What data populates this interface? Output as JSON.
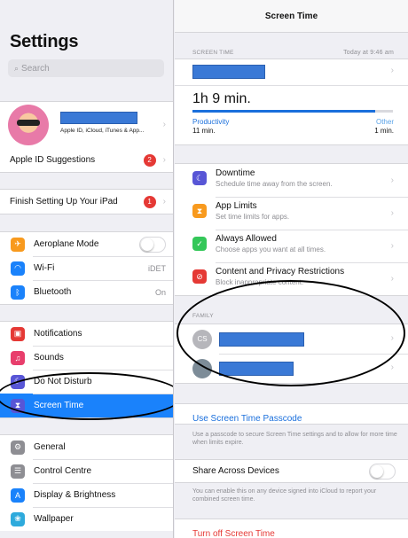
{
  "settings": {
    "title": "Settings",
    "search_placeholder": "Search",
    "apple_id_sub": "Apple ID, iCloud, iTunes & App...",
    "apple_id_suggestions": "Apple ID Suggestions",
    "apple_id_suggestions_badge": "2",
    "finish_setup": "Finish Setting Up Your iPad",
    "finish_setup_badge": "1",
    "connectivity": [
      {
        "label": "Aeroplane Mode",
        "icon": "airplane-icon",
        "color": "#f89a1e"
      },
      {
        "label": "Wi-Fi",
        "icon": "wifi-icon",
        "color": "#1a82fb",
        "value": "iDET"
      },
      {
        "label": "Bluetooth",
        "icon": "bluetooth-icon",
        "color": "#1a82fb",
        "value": "On"
      }
    ],
    "notifications_group": [
      {
        "label": "Notifications",
        "icon": "notifications-icon",
        "color": "#e53935"
      },
      {
        "label": "Sounds",
        "icon": "sounds-icon",
        "color": "#e83e6c"
      },
      {
        "label": "Do Not Disturb",
        "icon": "moon-icon",
        "color": "#5856d6"
      },
      {
        "label": "Screen Time",
        "icon": "hourglass-icon",
        "color": "#5856d6"
      }
    ],
    "general_group": [
      {
        "label": "General",
        "icon": "gear-icon",
        "color": "#8e8e93"
      },
      {
        "label": "Control Centre",
        "icon": "control-centre-icon",
        "color": "#8e8e93"
      },
      {
        "label": "Display & Brightness",
        "icon": "display-icon",
        "color": "#1a82fb"
      },
      {
        "label": "Wallpaper",
        "icon": "wallpaper-icon",
        "color": "#2eaadc"
      }
    ]
  },
  "screen_time": {
    "nav_title": "Screen Time",
    "section_label": "SCREEN TIME",
    "timestamp": "Today at 9:46 am",
    "total": "1h 9 min.",
    "productivity_label": "Productivity",
    "productivity_value": "11 min.",
    "other_label": "Other",
    "other_value": "1 min.",
    "productivity_fraction": 0.91,
    "items": [
      {
        "title": "Downtime",
        "subtitle": "Schedule time away from the screen.",
        "icon": "downtime-icon",
        "color": "#5856d6"
      },
      {
        "title": "App Limits",
        "subtitle": "Set time limits for apps.",
        "icon": "hourglass-icon",
        "color": "#f89a1e"
      },
      {
        "title": "Always Allowed",
        "subtitle": "Choose apps you want at all times.",
        "icon": "check-icon",
        "color": "#34c759"
      },
      {
        "title": "Content and Privacy Restrictions",
        "subtitle": "Block inappropriate content.",
        "icon": "restrict-icon",
        "color": "#e53935"
      }
    ],
    "family_label": "FAMILY",
    "family_initials": "CS",
    "passcode_link": "Use Screen Time Passcode",
    "passcode_note": "Use a passcode to secure Screen Time settings and to allow for more time when limits expire.",
    "share_label": "Share Across Devices",
    "share_note": "You can enable this on any device signed into iCloud to report your combined screen time.",
    "turn_off": "Turn off Screen Time"
  }
}
